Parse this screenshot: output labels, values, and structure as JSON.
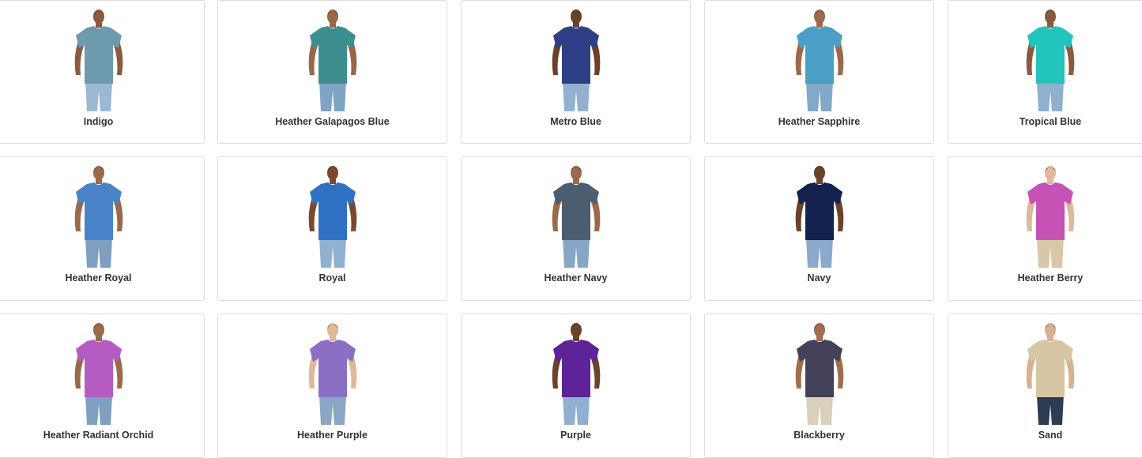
{
  "swatches": [
    {
      "label": "Indigo",
      "shirt": "#6e9aae",
      "pants": "#9cb8d3",
      "skin": "#8c5a3c"
    },
    {
      "label": "Heather Galapagos Blue",
      "shirt": "#3d8f8e",
      "pants": "#7fa3c2",
      "skin": "#9a6646"
    },
    {
      "label": "Metro Blue",
      "shirt": "#2e3f86",
      "pants": "#93b1cf",
      "skin": "#6a4128"
    },
    {
      "label": "Heather Sapphire",
      "shirt": "#4a9fc6",
      "pants": "#84a8c8",
      "skin": "#9c6a4a"
    },
    {
      "label": "Tropical Blue",
      "shirt": "#23c4bc",
      "pants": "#8fb0cf",
      "skin": "#8a5a3e"
    },
    {
      "label": "Heather Royal",
      "shirt": "#4a82c8",
      "pants": "#7f9fc0",
      "skin": "#9a6a4a"
    },
    {
      "label": "Royal",
      "shirt": "#2f72c4",
      "pants": "#8fb1d2",
      "skin": "#7a4a2e"
    },
    {
      "label": "Heather Navy",
      "shirt": "#4b5d6e",
      "pants": "#86a6c6",
      "skin": "#9a6a4a"
    },
    {
      "label": "Navy",
      "shirt": "#14224f",
      "pants": "#8aaacb",
      "skin": "#6c4228"
    },
    {
      "label": "Heather Berry",
      "shirt": "#c552b4",
      "pants": "#d9c8a8",
      "skin": "#e0b89a"
    },
    {
      "label": "Heather Radiant Orchid",
      "shirt": "#b55cc2",
      "pants": "#7f9fc0",
      "skin": "#9a6a4a"
    },
    {
      "label": "Heather Purple",
      "shirt": "#8a6fc4",
      "pants": "#8aa6c2",
      "skin": "#e0b898"
    },
    {
      "label": "Purple",
      "shirt": "#5f2399",
      "pants": "#8fb0cf",
      "skin": "#6c4228"
    },
    {
      "label": "Blackberry",
      "shirt": "#43405a",
      "pants": "#d8d0bc",
      "skin": "#a06e4e"
    },
    {
      "label": "Sand",
      "shirt": "#d6c6a4",
      "pants": "#2f3b52",
      "skin": "#d8b090"
    }
  ]
}
